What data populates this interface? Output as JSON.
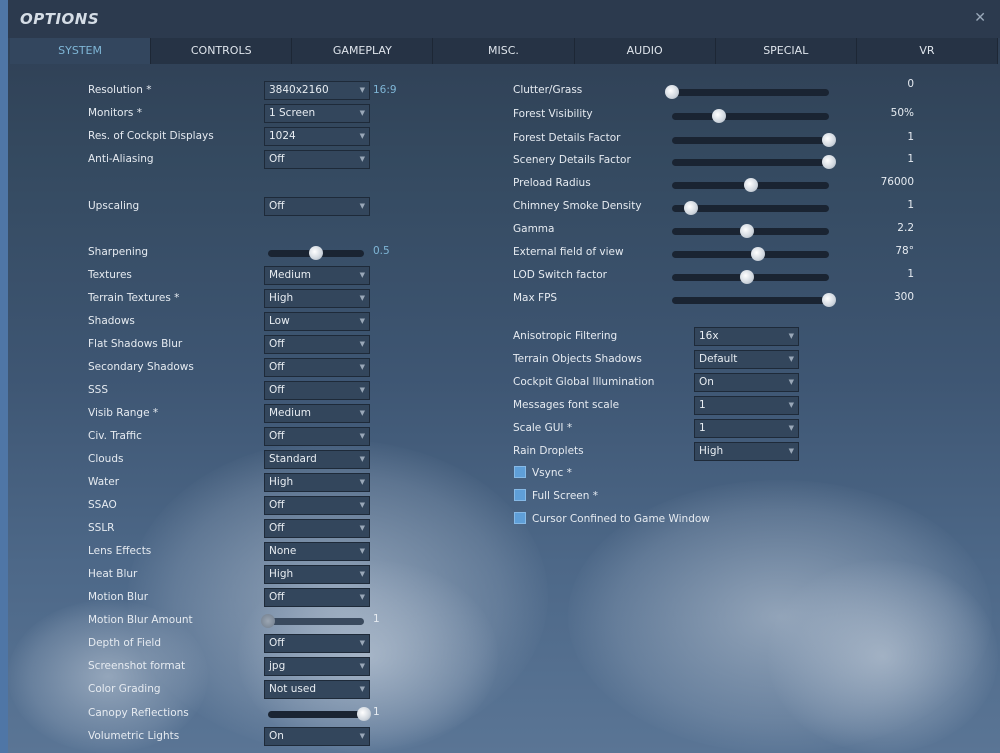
{
  "window": {
    "title": "OPTIONS",
    "close_icon": "✕"
  },
  "tabs": [
    {
      "label": "SYSTEM",
      "active": true
    },
    {
      "label": "CONTROLS"
    },
    {
      "label": "GAMEPLAY"
    },
    {
      "label": "MISC."
    },
    {
      "label": "AUDIO"
    },
    {
      "label": "SPECIAL"
    },
    {
      "label": "VR"
    }
  ],
  "aspect_ratio": "16:9",
  "left": [
    {
      "label": "Resolution *",
      "type": "select",
      "value": "3840x2160"
    },
    {
      "label": "Monitors *",
      "type": "select",
      "value": "1 Screen"
    },
    {
      "label": "Res. of Cockpit Displays",
      "type": "select",
      "value": "1024"
    },
    {
      "label": "Anti-Aliasing",
      "type": "select",
      "value": "Off"
    },
    {
      "label": "Upscaling",
      "type": "select",
      "value": "Off"
    },
    {
      "label": "Sharpening",
      "type": "slider",
      "value": "0.5",
      "fraction": 0.5
    },
    {
      "label": "Textures",
      "type": "select",
      "value": "Medium"
    },
    {
      "label": "Terrain Textures *",
      "type": "select",
      "value": "High"
    },
    {
      "label": "Shadows",
      "type": "select",
      "value": "Low"
    },
    {
      "label": "Flat Shadows Blur",
      "type": "select",
      "value": "Off"
    },
    {
      "label": "Secondary Shadows",
      "type": "select",
      "value": "Off"
    },
    {
      "label": "SSS",
      "type": "select",
      "value": "Off"
    },
    {
      "label": "Visib Range *",
      "type": "select",
      "value": "Medium"
    },
    {
      "label": "Civ. Traffic",
      "type": "select",
      "value": "Off"
    },
    {
      "label": "Clouds",
      "type": "select",
      "value": "Standard"
    },
    {
      "label": "Water",
      "type": "select",
      "value": "High"
    },
    {
      "label": "SSAO",
      "type": "select",
      "value": "Off"
    },
    {
      "label": "SSLR",
      "type": "select",
      "value": "Off"
    },
    {
      "label": "Lens Effects",
      "type": "select",
      "value": "None"
    },
    {
      "label": "Heat Blur",
      "type": "select",
      "value": "High"
    },
    {
      "label": "Motion Blur",
      "type": "select",
      "value": "Off"
    },
    {
      "label": "Motion Blur Amount",
      "type": "slider",
      "value": "1",
      "fraction": 0,
      "disabled": true
    },
    {
      "label": "Depth of Field",
      "type": "select",
      "value": "Off"
    },
    {
      "label": "Screenshot format",
      "type": "select",
      "value": "jpg"
    },
    {
      "label": "Color Grading",
      "type": "select",
      "value": "Not used"
    },
    {
      "label": "Canopy Reflections",
      "type": "slider",
      "value": "1",
      "fraction": 1
    },
    {
      "label": "Volumetric Lights",
      "type": "select",
      "value": "On"
    }
  ],
  "right_sliders": [
    {
      "label": "Clutter/Grass",
      "value": "0",
      "fraction": 0
    },
    {
      "label": "Forest Visibility",
      "value": "50%",
      "fraction": 0.3
    },
    {
      "label": "Forest Details Factor",
      "value": "1",
      "fraction": 1
    },
    {
      "label": "Scenery Details Factor",
      "value": "1",
      "fraction": 1
    },
    {
      "label": "Preload Radius",
      "value": "76000",
      "fraction": 0.5
    },
    {
      "label": "Chimney Smoke Density",
      "value": "1",
      "fraction": 0.12
    },
    {
      "label": "Gamma",
      "value": "2.2",
      "fraction": 0.48
    },
    {
      "label": "External field of view",
      "value": "78°",
      "fraction": 0.55
    },
    {
      "label": "LOD Switch factor",
      "value": "1",
      "fraction": 0.48
    },
    {
      "label": "Max FPS",
      "value": "300",
      "fraction": 1
    }
  ],
  "right_selects": [
    {
      "label": "Anisotropic Filtering",
      "value": "16x"
    },
    {
      "label": "Terrain Objects Shadows",
      "value": "Default"
    },
    {
      "label": "Cockpit Global Illumination",
      "value": "On"
    },
    {
      "label": "Messages font scale",
      "value": "1"
    },
    {
      "label": "Scale GUI *",
      "value": "1"
    },
    {
      "label": "Rain Droplets",
      "value": "High"
    }
  ],
  "checkboxes": [
    {
      "label": "Vsync *",
      "checked": false
    },
    {
      "label": "Full Screen *",
      "checked": false
    },
    {
      "label": "Cursor Confined to Game Window",
      "checked": false
    }
  ],
  "colors": {
    "accent": "#7fb6d6",
    "checkbox": "#5f9fd8"
  }
}
